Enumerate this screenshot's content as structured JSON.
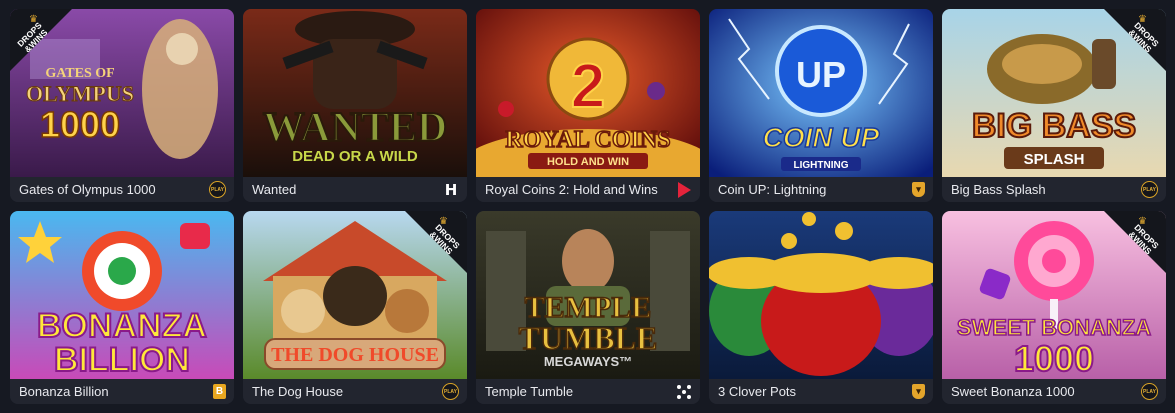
{
  "badge_text": "DROPS &WINS",
  "games": [
    {
      "title": "Gates of Olympus 1000",
      "logo": [
        "GATES OF",
        "OLYMPUS",
        "1000"
      ],
      "provider_icon": "play-n-go-icon",
      "badge": true,
      "colors": [
        "#6d3a8a",
        "#c9a04a"
      ]
    },
    {
      "title": "Wanted",
      "logo": [
        "WANTED",
        "DEAD OR A WILD"
      ],
      "provider_icon": "hacksaw-icon",
      "badge": false,
      "colors": [
        "#5a2418",
        "#2a1a12"
      ]
    },
    {
      "title": "Royal Coins 2: Hold and Wins",
      "logo": [
        "2",
        "ROYAL COINS",
        "HOLD AND WIN"
      ],
      "provider_icon": "playson-icon",
      "badge": false,
      "colors": [
        "#8a1a1a",
        "#e0a030"
      ]
    },
    {
      "title": "Coin UP: Lightning",
      "logo": [
        "UP",
        "COIN UP",
        "LIGHTNING"
      ],
      "provider_icon": "shield-icon",
      "badge": false,
      "colors": [
        "#0d2d8a",
        "#3a8ef0"
      ]
    },
    {
      "title": "Big Bass Splash",
      "logo": [
        "BIG BASS",
        "SPLASH"
      ],
      "provider_icon": "play-n-go-icon",
      "badge": true,
      "colors": [
        "#8cc0d8",
        "#c58a3a"
      ]
    },
    {
      "title": "Bonanza Billion",
      "logo": [
        "BONANZA",
        "BILLION"
      ],
      "provider_icon": "b-icon",
      "badge": false,
      "colors": [
        "#3aa8e8",
        "#e84aa8"
      ]
    },
    {
      "title": "The Dog House",
      "logo": [
        "THE DOG HOUSE"
      ],
      "provider_icon": "play-n-go-icon",
      "badge": true,
      "colors": [
        "#6a9a3a",
        "#b8c84a"
      ]
    },
    {
      "title": "Temple Tumble",
      "logo": [
        "TEMPLE",
        "TUMBLE",
        "MEGAWAYS™"
      ],
      "provider_icon": "relax-dots-icon",
      "badge": false,
      "colors": [
        "#2a2a20",
        "#6a5a30"
      ]
    },
    {
      "title": "3 Clover Pots",
      "logo": [],
      "provider_icon": "shield-icon",
      "badge": false,
      "colors": [
        "#1a3a6a",
        "#2a6a3a"
      ]
    },
    {
      "title": "Sweet Bonanza 1000",
      "logo": [
        "SWEET BONANZA",
        "1000"
      ],
      "provider_icon": "play-n-go-icon",
      "badge": true,
      "colors": [
        "#e8a0c8",
        "#c870b0"
      ]
    }
  ],
  "provider_labels": {
    "play": "PLAY",
    "h": "H",
    "shield": "▾",
    "b": "B"
  }
}
